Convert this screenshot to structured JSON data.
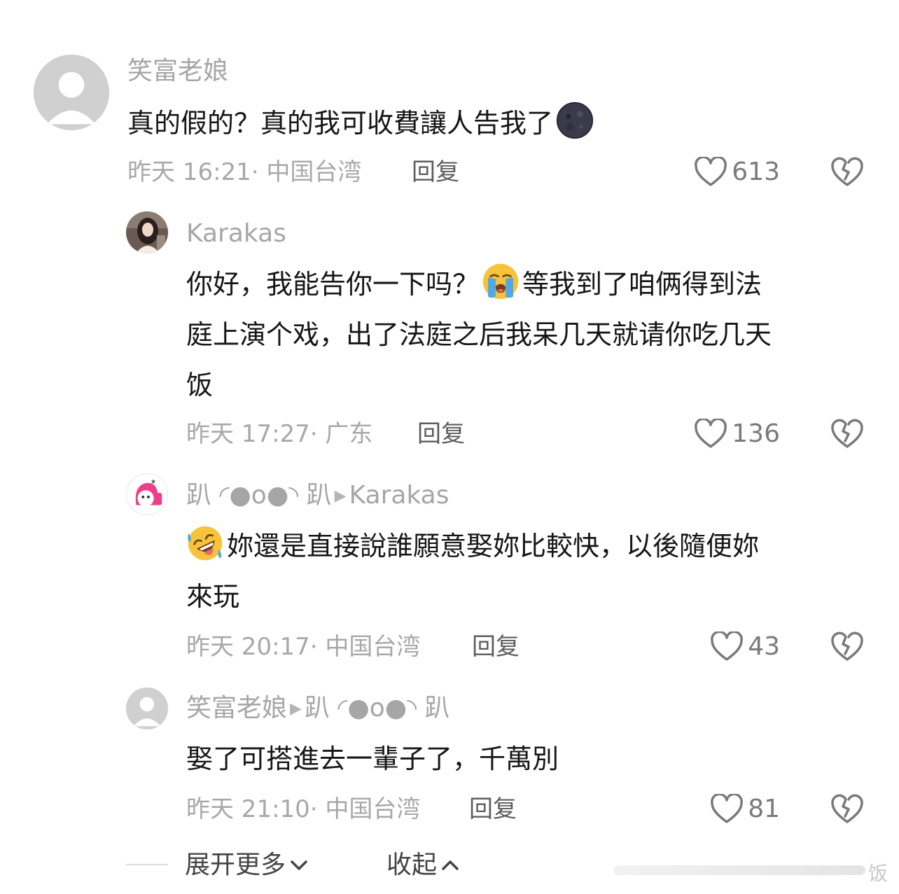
{
  "comments": [
    {
      "username": "笑富老娘",
      "reply_to": "",
      "text": "真的假的？真的我可收費讓人告我了",
      "emoji": "new-moon-face",
      "time": "昨天 16:21",
      "location": "中国台湾",
      "reply_label": "回复",
      "likes": "613"
    },
    {
      "username": "Karakas",
      "reply_to": "",
      "text_before_emoji": "你好，我能告你一下吗？",
      "emoji": "loudly-crying-face",
      "text_line1_rest": "等我到了咱俩得到法",
      "text_line2": "庭上演个戏，出了法庭之后我呆几天就请你吃几天",
      "text_line3": "饭",
      "time": "昨天 17:27",
      "location": "广东",
      "reply_label": "回复",
      "likes": "136"
    },
    {
      "username": "趴 ◜●o●◝ 趴",
      "reply_to": "Karakas",
      "emoji": "rolling-on-floor-laughing",
      "text_line1": "妳還是直接說誰願意娶妳比較快，以後隨便妳",
      "text_line2": "來玩",
      "time": "昨天 20:17",
      "location": "中国台湾",
      "reply_label": "回复",
      "likes": "43"
    },
    {
      "username": "笑富老娘",
      "reply_to": "趴 ◜●o●◝ 趴",
      "text": "娶了可搭進去一輩子了，千萬別",
      "time": "昨天 21:10",
      "location": "中国台湾",
      "reply_label": "回复",
      "likes": "81"
    }
  ],
  "footer": {
    "expand_label": "展开更多",
    "collapse_label": "收起"
  },
  "watermark": "饭",
  "colors": {
    "text": "#161616",
    "meta": "#a8a8a8",
    "username": "#a6a6a6",
    "reply": "#5d5d5d",
    "background": "#ffffff"
  }
}
